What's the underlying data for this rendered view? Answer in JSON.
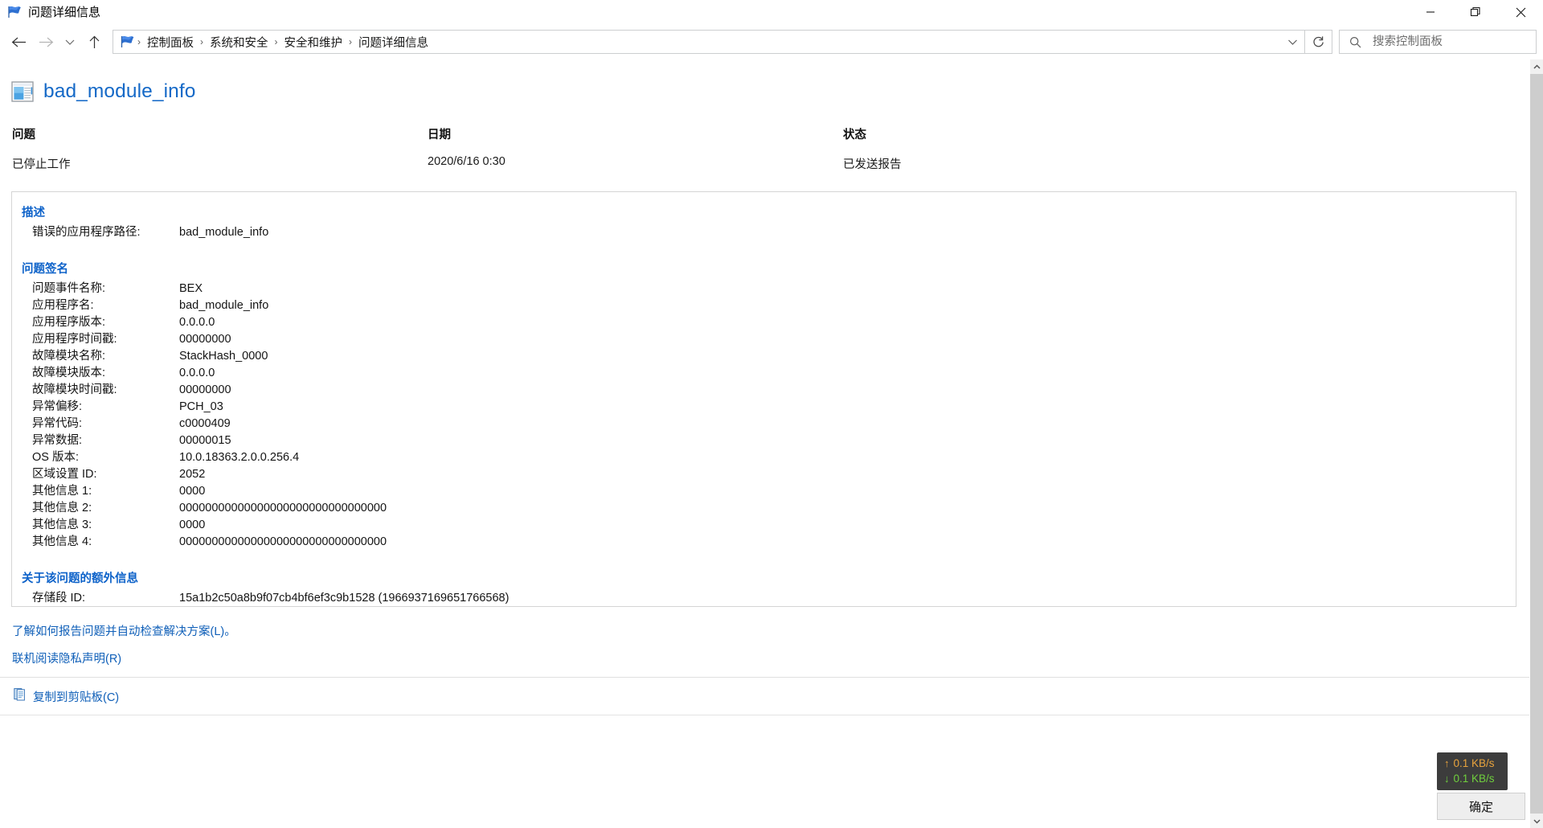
{
  "window": {
    "title": "问题详细信息",
    "icon": "flag-icon",
    "controls": {
      "minimize": "minimize-icon",
      "maximize": "restore-icon",
      "close": "close-icon"
    }
  },
  "nav": {
    "back": "back-arrow-icon",
    "forward": "forward-arrow-icon",
    "recent": "chevron-down-icon",
    "up": "up-arrow-icon",
    "breadcrumbs": [
      "控制面板",
      "系统和安全",
      "安全和维护",
      "问题详细信息"
    ],
    "separator": "›",
    "dropdown": "chevron-down-icon",
    "refresh": "refresh-icon"
  },
  "search": {
    "placeholder": "搜索控制面板",
    "value": "",
    "icon": "search-icon"
  },
  "page": {
    "title": "bad_module_info",
    "icon": "window-app-icon"
  },
  "summary": {
    "columns": [
      {
        "header": "问题",
        "value": "已停止工作"
      },
      {
        "header": "日期",
        "value": "2020/6/16 0:30"
      },
      {
        "header": "状态",
        "value": "已发送报告"
      }
    ]
  },
  "sections": [
    {
      "heading": "描述",
      "rows": [
        {
          "key": "错误的应用程序路径:",
          "value": "bad_module_info"
        }
      ]
    },
    {
      "heading": "问题签名",
      "rows": [
        {
          "key": "问题事件名称:",
          "value": "BEX"
        },
        {
          "key": "应用程序名:",
          "value": "bad_module_info"
        },
        {
          "key": "应用程序版本:",
          "value": "0.0.0.0"
        },
        {
          "key": "应用程序时间戳:",
          "value": "00000000"
        },
        {
          "key": "故障模块名称:",
          "value": "StackHash_0000"
        },
        {
          "key": "故障模块版本:",
          "value": "0.0.0.0"
        },
        {
          "key": "故障模块时间戳:",
          "value": "00000000"
        },
        {
          "key": "异常偏移:",
          "value": "PCH_03"
        },
        {
          "key": "异常代码:",
          "value": "c0000409"
        },
        {
          "key": "异常数据:",
          "value": "00000015"
        },
        {
          "key": "OS 版本:",
          "value": "10.0.18363.2.0.0.256.4"
        },
        {
          "key": "区域设置 ID:",
          "value": "2052"
        },
        {
          "key": "其他信息 1:",
          "value": "0000"
        },
        {
          "key": "其他信息 2:",
          "value": "00000000000000000000000000000000"
        },
        {
          "key": "其他信息 3:",
          "value": "0000"
        },
        {
          "key": "其他信息 4:",
          "value": "00000000000000000000000000000000"
        }
      ]
    },
    {
      "heading": "关于该问题的额外信息",
      "rows": [
        {
          "key": "存储段 ID:",
          "value": "15a1b2c50a8b9f07cb4bf6ef3c9b1528 (1966937169651766568)"
        }
      ]
    }
  ],
  "links": [
    "了解如何报告问题并自动检查解决方案(L)。",
    "联机阅读隐私声明(R)"
  ],
  "copy_action": {
    "label": "复制到剪贴板(C)",
    "icon": "clipboard-icon"
  },
  "footer": {
    "ok_label": "确定"
  },
  "network_widget": {
    "upload": "0.1 KB/s",
    "download": "0.1 KB/s",
    "up_arrow": "↑",
    "down_arrow": "↓",
    "up_color": "#e8a33d",
    "down_color": "#6fcf3d",
    "background": "#3c3c3c"
  },
  "scrollbar": {
    "up_arrow": "scroll-up-icon",
    "down_arrow": "scroll-down-icon"
  },
  "colors": {
    "link": "#0f5fb8",
    "heading": "#0d62c9",
    "title": "#1569c7"
  }
}
